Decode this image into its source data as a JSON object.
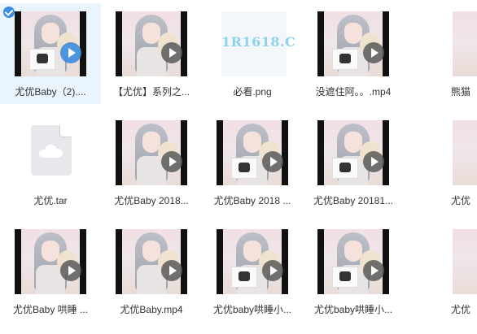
{
  "files": [
    {
      "name": "尤优Baby（2)....",
      "type": "video",
      "selected": true,
      "sign": true
    },
    {
      "name": "【尤优】系列之...",
      "type": "video",
      "sign": false
    },
    {
      "name": "必看.png",
      "type": "image",
      "thumb_text": "1R1618.C"
    },
    {
      "name": "没遮住阿。。.mp4",
      "type": "video",
      "sign": true
    },
    {
      "name": "熊猫",
      "type": "video",
      "sign": false
    },
    {
      "name": "尤优.tar",
      "type": "archive"
    },
    {
      "name": "尤优Baby  2018...",
      "type": "video",
      "sign": false
    },
    {
      "name": "尤优Baby 2018 ...",
      "type": "video",
      "sign": true
    },
    {
      "name": "尤优Baby 20181...",
      "type": "video",
      "sign": true
    },
    {
      "name": "尤优",
      "type": "video",
      "sign": false
    },
    {
      "name": "尤优Baby 哄睡 ...",
      "type": "video",
      "sign": false
    },
    {
      "name": "尤优Baby.mp4",
      "type": "video",
      "sign": false
    },
    {
      "name": "尤优baby哄睡小...",
      "type": "video",
      "sign": true
    },
    {
      "name": "尤优baby哄睡小...",
      "type": "video",
      "sign": true
    },
    {
      "name": "尤优",
      "type": "video",
      "sign": false
    }
  ],
  "colors": {
    "selection": "#eaf4fd",
    "accent": "#3a8de0"
  }
}
